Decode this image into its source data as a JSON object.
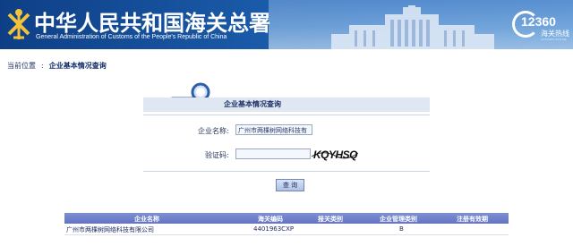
{
  "header": {
    "title_cn": "中华人民共和国海关总署",
    "title_en": "General Administration of Customs of the People's Republic of China",
    "hotline_number": "12360",
    "hotline_label": "海关热线",
    "hotline_sub": "CUSTOMS HOTLINE",
    "icons": [
      "customs-emblem-icon",
      "customs-building-illustration",
      "phone-ring-icon"
    ]
  },
  "breadcrumb": {
    "prefix": "当前位置",
    "separator": ":",
    "current": "企业基本情况查询"
  },
  "query_panel": {
    "title": "企业基本情况查询",
    "icon": "magnifier-document-icon",
    "company_label": "企业名称:",
    "company_value": "广州市两棵树网络科技有",
    "captcha_label": "验证码:",
    "captcha_value": "",
    "captcha_text": "KQYHSQ",
    "query_button": "查 询"
  },
  "results": {
    "columns": [
      "企业名称",
      "海关编码",
      "报关类别",
      "企业管理类别",
      "注册有效期"
    ],
    "rows": [
      {
        "name": "广州市两棵树网络科技有限公司",
        "code": "4401963CXP",
        "declare_type": "",
        "mgmt_class": "B",
        "valid_until": ""
      }
    ]
  },
  "colors": {
    "banner_dark": "#0e3f86",
    "banner_light": "#4a93d6",
    "table_header": "#6f7fcb",
    "text_link": "#1d2d66"
  }
}
